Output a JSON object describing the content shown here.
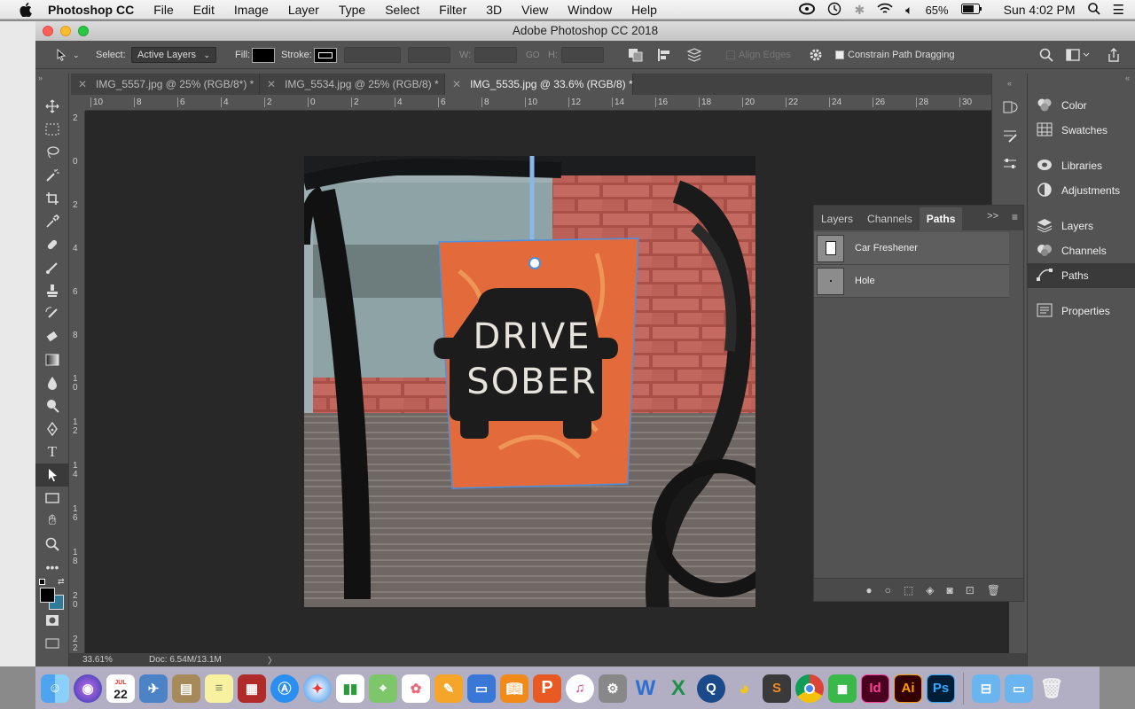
{
  "menubar": {
    "apple_icon": "apple-logo",
    "app": "Photoshop CC",
    "items": [
      "File",
      "Edit",
      "Image",
      "Layer",
      "Type",
      "Select",
      "Filter",
      "3D",
      "View",
      "Window",
      "Help"
    ],
    "battery": "65%",
    "clock": "Sun 4:02 PM"
  },
  "window": {
    "title": "Adobe Photoshop CC 2018"
  },
  "options": {
    "select_label": "Select:",
    "select_value": "Active Layers",
    "fill_label": "Fill:",
    "stroke_label": "Stroke:",
    "w_label": "W:",
    "go_label": "GO",
    "h_label": "H:",
    "align_edges": "Align Edges",
    "constrain": "Constrain Path Dragging"
  },
  "tabs": [
    {
      "label": "IMG_5557.jpg @ 25% (RGB/8*) *"
    },
    {
      "label": "IMG_5534.jpg @ 25% (RGB/8) *"
    },
    {
      "label": "IMG_5535.jpg @ 33.6% (RGB/8) *"
    }
  ],
  "ruler": {
    "h": [
      "10",
      "8",
      "6",
      "4",
      "2",
      "0",
      "2",
      "4",
      "6",
      "8",
      "10",
      "12",
      "14",
      "16",
      "18",
      "20",
      "22",
      "24",
      "26",
      "28",
      "30"
    ],
    "v": [
      "2",
      "0",
      "2",
      "4",
      "6",
      "8",
      "1\n0",
      "1\n2",
      "1\n4",
      "1\n6",
      "1\n8",
      "2\n0",
      "2\n2"
    ]
  },
  "photo": {
    "tag_line1": "DRIVE",
    "tag_line2": "SOBER"
  },
  "status": {
    "zoom": "33.61%",
    "doc": "Doc: 6.54M/13.1M",
    "arrow": "〉"
  },
  "right_dock": {
    "items": [
      {
        "label": "Color",
        "icon": "color-icon"
      },
      {
        "label": "Swatches",
        "icon": "swatches-icon"
      },
      {
        "label": "Libraries",
        "icon": "libraries-icon"
      },
      {
        "label": "Adjustments",
        "icon": "adjustments-icon"
      },
      {
        "label": "Layers",
        "icon": "layers-icon"
      },
      {
        "label": "Channels",
        "icon": "channels-icon"
      },
      {
        "label": "Paths",
        "icon": "paths-icon"
      },
      {
        "label": "Properties",
        "icon": "properties-icon"
      }
    ]
  },
  "paths_panel": {
    "tabs": [
      "Layers",
      "Channels",
      "Paths"
    ],
    "active_tab": "Paths",
    "collapse": ">>",
    "rows": [
      {
        "name": "Car Freshener"
      },
      {
        "name": "Hole"
      }
    ]
  },
  "dock": {
    "calendar_month": "JUL",
    "calendar_day": "22"
  }
}
